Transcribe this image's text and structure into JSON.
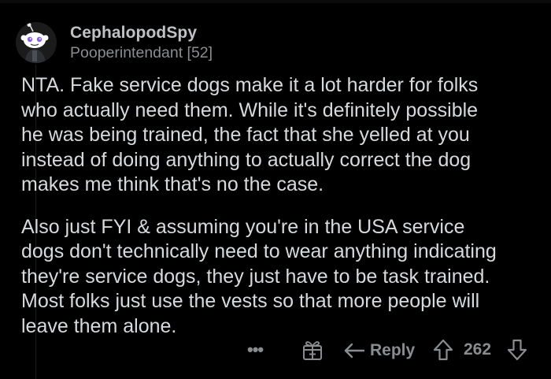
{
  "comment": {
    "username": "CephalopodSpy",
    "flair": "Pooperintendant [52]",
    "body": [
      [
        "NTA.  Fake service dogs make it a lot harder for folks",
        "who actually need them.  While it's definitely possible",
        "he was being trained, the fact that she yelled at you",
        "instead of doing anything to actually correct the dog",
        "makes me think that's no the case."
      ],
      [
        "Also just FYI & assuming you're in the USA service",
        "dogs don't technically need to wear anything indicating",
        "they're service dogs, they just have to be task trained.",
        "Most folks just use the vests so that more people will",
        "leave them alone."
      ]
    ]
  },
  "actions": {
    "more_label": "•••",
    "award_icon": "gift-award-icon",
    "reply_icon": "reply-arrow-icon",
    "reply_label": "Reply",
    "upvote_icon": "upvote-arrow-icon",
    "score": "262",
    "downvote_icon": "downvote-arrow-icon"
  },
  "colors": {
    "background": "#000000",
    "body_text": "#d7dadc",
    "username": "#bfc2c5",
    "muted": "#8a8d90",
    "avatar_accent": "#8a5cf5"
  }
}
